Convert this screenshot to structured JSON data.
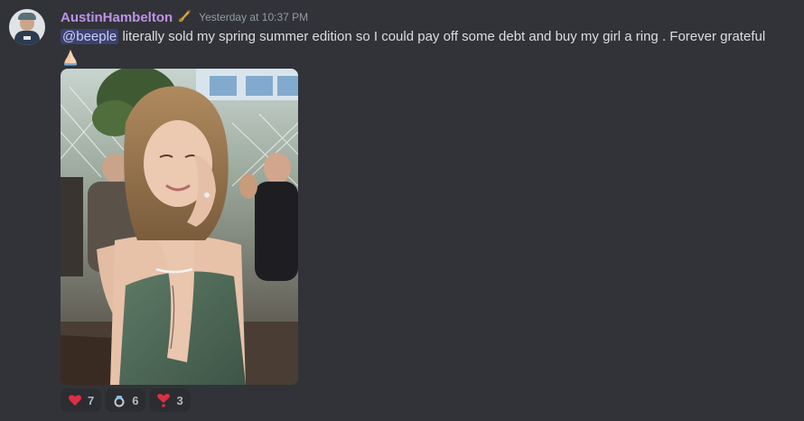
{
  "message": {
    "author": "AustinHambelton",
    "role_icon": "saxophone-icon",
    "timestamp": "Yesterday at 10:37 PM",
    "mention": "@beeple",
    "text": " literally sold my spring summer edition so I could pay off some debt and buy my girl a ring . Forever grateful",
    "trailing_emoji": "folded-hands-icon",
    "attachment": "photo-woman-in-green-dress"
  },
  "reactions": [
    {
      "emoji": "heart-icon",
      "count": "7"
    },
    {
      "emoji": "ring-icon",
      "count": "6"
    },
    {
      "emoji": "heart-exclamation-icon",
      "count": "3"
    }
  ],
  "colors": {
    "background": "#313338",
    "username": "#bf92e6",
    "mention_bg": "#5865f24d",
    "reaction_bg": "#2b2d31"
  }
}
